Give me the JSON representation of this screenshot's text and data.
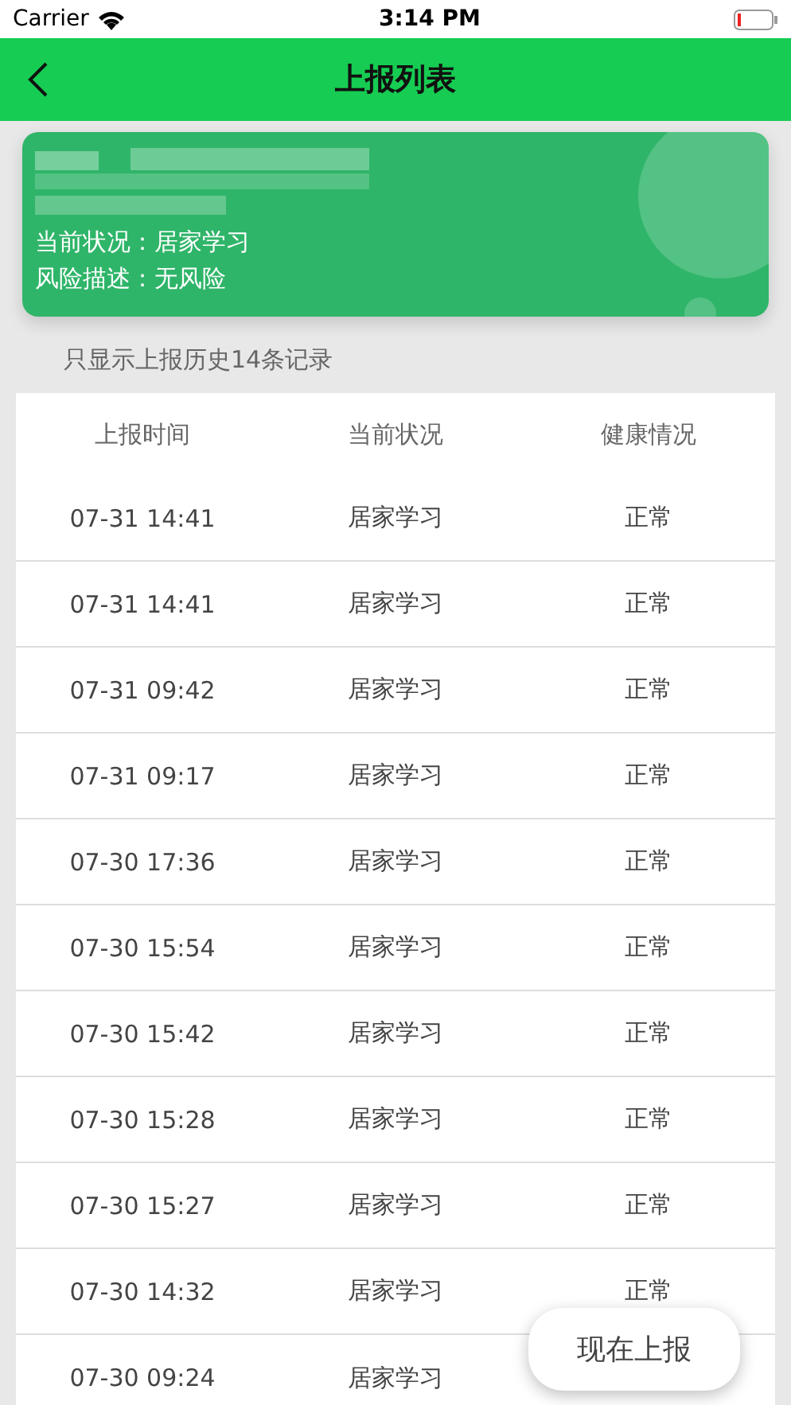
{
  "status_bar": {
    "carrier": "Carrier",
    "time": "3:14 PM"
  },
  "nav_bar": {
    "title": "上报列表"
  },
  "card": {
    "status": "当前状况：居家学习",
    "risk": "风险描述：无风险"
  },
  "note": "只显示上报历史14条记录",
  "table": {
    "columns": [
      "上报时间",
      "当前状况",
      "健康情况"
    ],
    "rows": [
      {
        "time": "07-31 14:41",
        "status": "居家学习",
        "health": "正常"
      },
      {
        "time": "07-31 14:41",
        "status": "居家学习",
        "health": "正常"
      },
      {
        "time": "07-31 09:42",
        "status": "居家学习",
        "health": "正常"
      },
      {
        "time": "07-31 09:17",
        "status": "居家学习",
        "health": "正常"
      },
      {
        "time": "07-30 17:36",
        "status": "居家学习",
        "health": "正常"
      },
      {
        "time": "07-30 15:54",
        "status": "居家学习",
        "health": "正常"
      },
      {
        "time": "07-30 15:42",
        "status": "居家学习",
        "health": "正常"
      },
      {
        "time": "07-30 15:28",
        "status": "居家学习",
        "health": "正常"
      },
      {
        "time": "07-30 15:27",
        "status": "居家学习",
        "health": "正常"
      },
      {
        "time": "07-30 14:32",
        "status": "居家学习",
        "health": "正常"
      },
      {
        "time": "07-30 09:24",
        "status": "居家学习"
      }
    ]
  },
  "report_button": "现在上报"
}
